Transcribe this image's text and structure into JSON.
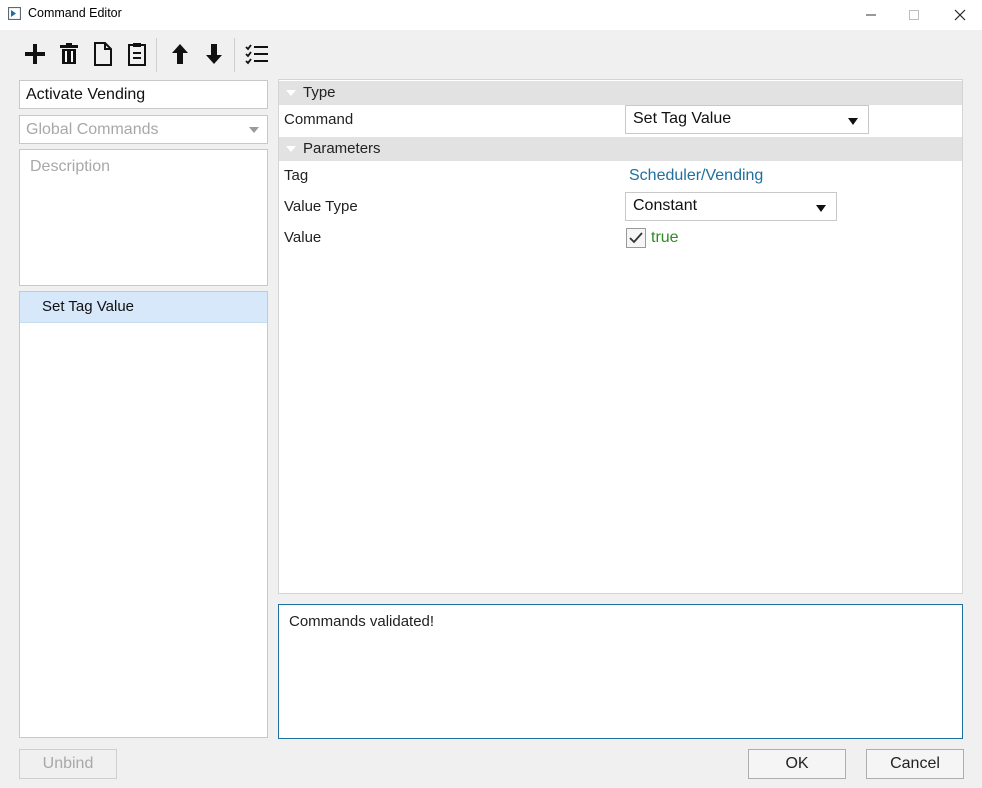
{
  "window": {
    "title": "Command Editor",
    "controls": {
      "minimize": "minimize-icon",
      "maximize": "maximize-icon",
      "close": "close-icon"
    }
  },
  "toolbar": {
    "icons": [
      "add-icon",
      "delete-icon",
      "copy-icon",
      "paste-icon",
      "move-up-icon",
      "move-down-icon",
      "validate-list-icon"
    ]
  },
  "left": {
    "name_value": "Activate Vending",
    "scope_placeholder": "Global Commands",
    "description_placeholder": "Description",
    "commands": [
      {
        "label": "Set Tag Value",
        "selected": true
      }
    ]
  },
  "grid": {
    "categories": {
      "type": "Type",
      "parameters": "Parameters"
    },
    "rows": {
      "command_label": "Command",
      "command_value": "Set Tag Value",
      "tag_label": "Tag",
      "tag_value": "Scheduler/Vending",
      "value_type_label": "Value Type",
      "value_type_value": "Constant",
      "value_label": "Value",
      "value_value": "true",
      "value_checked": true
    }
  },
  "output": {
    "message": "Commands validated!"
  },
  "buttons": {
    "unbind": "Unbind",
    "ok": "OK",
    "cancel": "Cancel"
  },
  "colors": {
    "accent": "#1f6f9f",
    "selection": "#d6e8f9",
    "true_value": "#2e8b22",
    "category_bg": "#e2e2e2"
  }
}
